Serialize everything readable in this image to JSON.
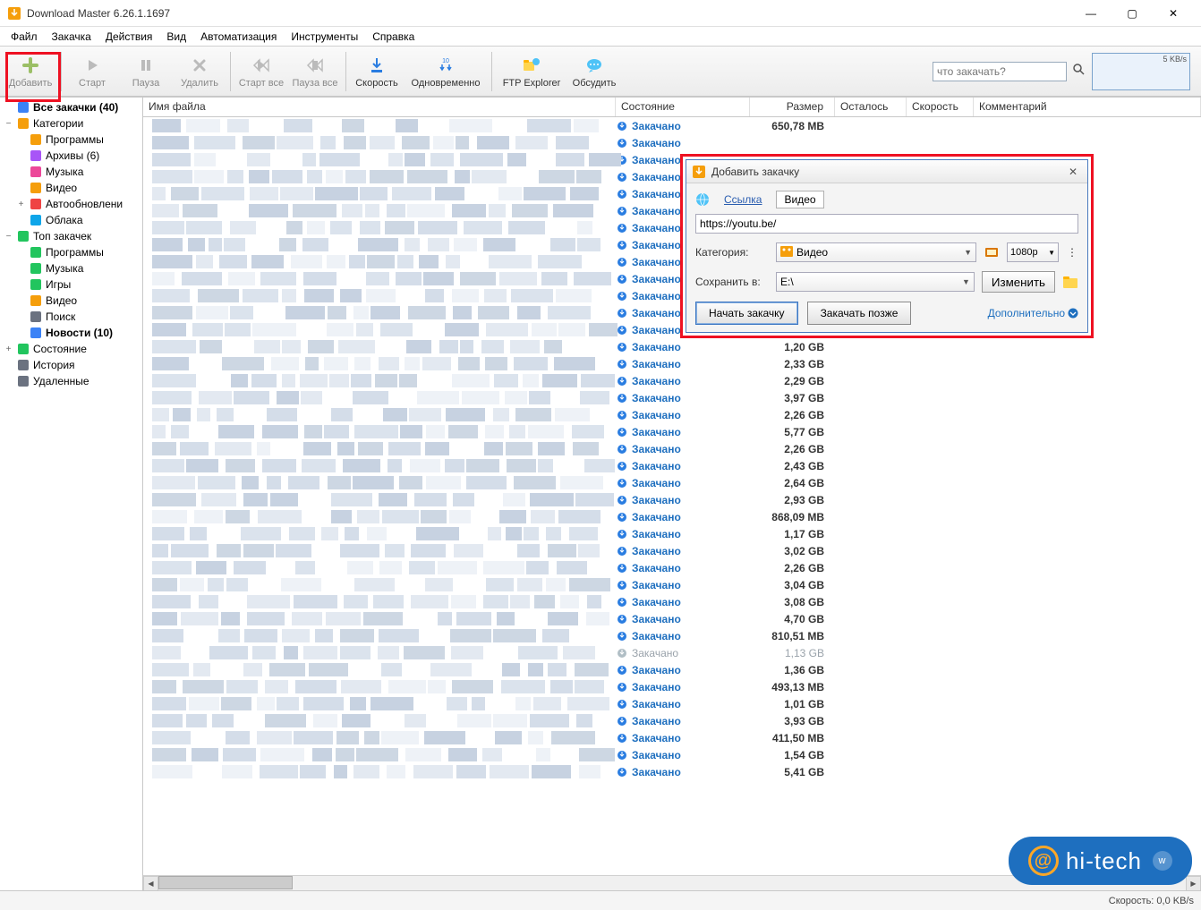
{
  "window": {
    "title": "Download Master 6.26.1.1697",
    "controls": {
      "min": "—",
      "max": "▢",
      "close": "✕"
    }
  },
  "menu": [
    "Файл",
    "Закачка",
    "Действия",
    "Вид",
    "Автоматизация",
    "Инструменты",
    "Справка"
  ],
  "toolbar": {
    "add": "Добавить",
    "start": "Старт",
    "pause": "Пауза",
    "delete": "Удалить",
    "start_all": "Старт все",
    "pause_all": "Пауза все",
    "speed": "Скорость",
    "simultaneous": "Одновременно",
    "ftp": "FTP Explorer",
    "discuss": "Обсудить",
    "search_placeholder": "что закачать?",
    "speed_label": "5 KB/s"
  },
  "sidebar": [
    {
      "lvl": 0,
      "exp": "",
      "icon": "#3b82f6",
      "label": "Все закачки (40)",
      "bold": true
    },
    {
      "lvl": 0,
      "exp": "−",
      "icon": "#f59e0b",
      "label": "Категории"
    },
    {
      "lvl": 1,
      "exp": "",
      "icon": "#f59e0b",
      "label": "Программы"
    },
    {
      "lvl": 1,
      "exp": "",
      "icon": "#a855f7",
      "label": "Архивы (6)"
    },
    {
      "lvl": 1,
      "exp": "",
      "icon": "#ec4899",
      "label": "Музыка"
    },
    {
      "lvl": 1,
      "exp": "",
      "icon": "#f59e0b",
      "label": "Видео"
    },
    {
      "lvl": 1,
      "exp": "+",
      "icon": "#ef4444",
      "label": "Автообновлени"
    },
    {
      "lvl": 1,
      "exp": "",
      "icon": "#0ea5e9",
      "label": "Облака"
    },
    {
      "lvl": 0,
      "exp": "−",
      "icon": "#22c55e",
      "label": "Топ закачек"
    },
    {
      "lvl": 1,
      "exp": "",
      "icon": "#22c55e",
      "label": "Программы"
    },
    {
      "lvl": 1,
      "exp": "",
      "icon": "#22c55e",
      "label": "Музыка"
    },
    {
      "lvl": 1,
      "exp": "",
      "icon": "#22c55e",
      "label": "Игры"
    },
    {
      "lvl": 1,
      "exp": "",
      "icon": "#f59e0b",
      "label": "Видео"
    },
    {
      "lvl": 1,
      "exp": "",
      "icon": "#6b7280",
      "label": "Поиск"
    },
    {
      "lvl": 1,
      "exp": "",
      "icon": "#3b82f6",
      "label": "Новости (10)",
      "bold": true
    },
    {
      "lvl": 0,
      "exp": "+",
      "icon": "#22c55e",
      "label": "Состояние"
    },
    {
      "lvl": 0,
      "exp": "",
      "icon": "#6b7280",
      "label": "История"
    },
    {
      "lvl": 0,
      "exp": "",
      "icon": "#6b7280",
      "label": "Удаленные"
    }
  ],
  "columns": {
    "filename": "Имя файла",
    "state": "Состояние",
    "size": "Размер",
    "remain": "Осталось",
    "speed": "Скорость",
    "comment": "Комментарий"
  },
  "rows": [
    {
      "state": "Закачано",
      "size": "650,78 MB",
      "bold": true
    },
    {
      "state": "Закачано",
      "size": "",
      "bold": true
    },
    {
      "state": "Закачано",
      "size": "",
      "bold": true
    },
    {
      "state": "Закачано",
      "size": "",
      "bold": true
    },
    {
      "state": "Закачано",
      "size": "",
      "bold": true
    },
    {
      "state": "Закачано",
      "size": "",
      "bold": true
    },
    {
      "state": "Закачано",
      "size": "",
      "bold": true
    },
    {
      "state": "Закачано",
      "size": "",
      "bold": true
    },
    {
      "state": "Закачано",
      "size": "",
      "bold": true
    },
    {
      "state": "Закачано",
      "size": "",
      "bold": true
    },
    {
      "state": "Закачано",
      "size": "",
      "bold": true
    },
    {
      "state": "Закачано",
      "size": "",
      "bold": true
    },
    {
      "state": "Закачано",
      "size": "",
      "bold": true
    },
    {
      "state": "Закачано",
      "size": "1,20 GB",
      "bold": true
    },
    {
      "state": "Закачано",
      "size": "2,33 GB",
      "bold": true
    },
    {
      "state": "Закачано",
      "size": "2,29 GB",
      "bold": true
    },
    {
      "state": "Закачано",
      "size": "3,97 GB",
      "bold": true
    },
    {
      "state": "Закачано",
      "size": "2,26 GB",
      "bold": true
    },
    {
      "state": "Закачано",
      "size": "5,77 GB",
      "bold": true
    },
    {
      "state": "Закачано",
      "size": "2,26 GB",
      "bold": true
    },
    {
      "state": "Закачано",
      "size": "2,43 GB",
      "bold": true
    },
    {
      "state": "Закачано",
      "size": "2,64 GB",
      "bold": true
    },
    {
      "state": "Закачано",
      "size": "2,93 GB",
      "bold": true
    },
    {
      "state": "Закачано",
      "size": "868,09 MB",
      "bold": true
    },
    {
      "state": "Закачано",
      "size": "1,17 GB",
      "bold": true
    },
    {
      "state": "Закачано",
      "size": "3,02 GB",
      "bold": true
    },
    {
      "state": "Закачано",
      "size": "2,26 GB",
      "bold": true
    },
    {
      "state": "Закачано",
      "size": "3,04 GB",
      "bold": true
    },
    {
      "state": "Закачано",
      "size": "3,08 GB",
      "bold": true
    },
    {
      "state": "Закачано",
      "size": "4,70 GB",
      "bold": true
    },
    {
      "state": "Закачано",
      "size": "810,51 MB",
      "bold": true
    },
    {
      "state": "Закачано",
      "size": "1,13 GB",
      "bold": false
    },
    {
      "state": "Закачано",
      "size": "1,36 GB",
      "bold": true
    },
    {
      "state": "Закачано",
      "size": "493,13 MB",
      "bold": true
    },
    {
      "state": "Закачано",
      "size": "1,01 GB",
      "bold": true
    },
    {
      "state": "Закачано",
      "size": "3,93 GB",
      "bold": true
    },
    {
      "state": "Закачано",
      "size": "411,50 MB",
      "bold": true
    },
    {
      "state": "Закачано",
      "size": "1,54 GB",
      "bold": true
    },
    {
      "state": "Закачано",
      "size": "5,41 GB",
      "bold": true
    }
  ],
  "dialog": {
    "title": "Добавить закачку",
    "tab_link": "Ссылка",
    "tab_video": "Видео",
    "url": "https://youtu.be/",
    "category_label": "Категория:",
    "category_value": "Видео",
    "quality": "1080p",
    "save_label": "Сохранить в:",
    "save_value": "E:\\",
    "change_btn": "Изменить",
    "start_btn": "Начать закачку",
    "later_btn": "Закачать позже",
    "more": "Дополнительно"
  },
  "statusbar": {
    "speed": "Скорость: 0,0 KB/s"
  },
  "watermark": "hi-tech"
}
